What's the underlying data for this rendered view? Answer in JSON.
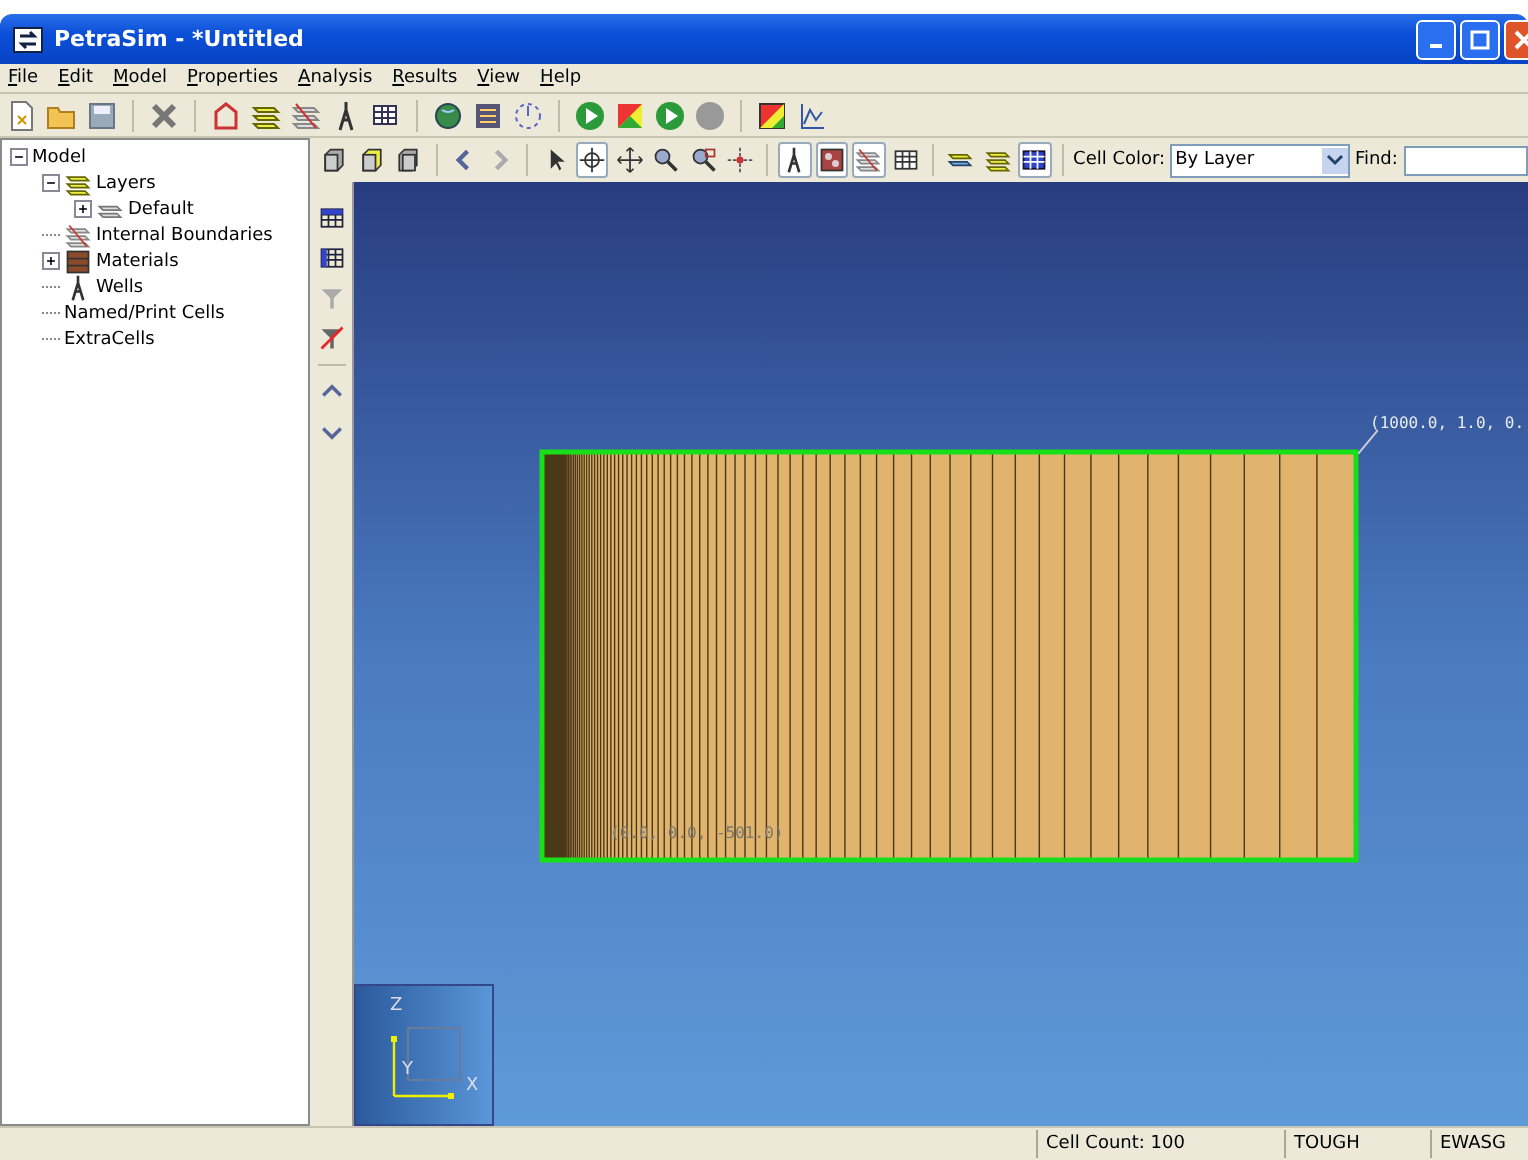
{
  "window": {
    "title": "PetraSim - *Untitled"
  },
  "menu": [
    "File",
    "Edit",
    "Model",
    "Properties",
    "Analysis",
    "Results",
    "View",
    "Help"
  ],
  "view_toolbar": {
    "buttons": [
      {
        "selected": false
      },
      {
        "selected": false
      },
      {
        "selected": false
      },
      {
        "selected": false
      },
      {
        "selected": false
      },
      {
        "selected": false
      },
      {
        "selected": true
      },
      {
        "selected": false
      },
      {
        "selected": false
      },
      {
        "selected": false
      },
      {
        "selected": false
      },
      {
        "selected": true
      },
      {
        "selected": true
      },
      {
        "selected": true
      },
      {
        "selected": false
      },
      {
        "selected": false
      },
      {
        "selected": false
      },
      {
        "selected": true
      }
    ],
    "cell_color": {
      "label": "Cell Color:",
      "value": "By Layer"
    },
    "find": {
      "label": "Find:"
    }
  },
  "tree": [
    {
      "label": "Model",
      "expanded": true,
      "children": [
        {
          "label": "Layers",
          "kind": "layers",
          "expanded": true,
          "children": [
            {
              "label": "Default",
              "kind": "layer",
              "expanded": false
            }
          ]
        },
        {
          "label": "Internal Boundaries",
          "kind": "boundaries"
        },
        {
          "label": "Materials",
          "kind": "materials",
          "expanded": false
        },
        {
          "label": "Wells",
          "kind": "wells"
        },
        {
          "label": "Named/Print Cells"
        },
        {
          "label": "ExtraCells"
        }
      ]
    }
  ],
  "viewport": {
    "label_top_right": "(1000.0, 1.0, 0.",
    "label_bottom_left": "(0.0, 0.0, -501.0)",
    "axes": {
      "z": "Z",
      "y": "Y",
      "x": "X"
    }
  },
  "status_bar": {
    "cell_count": "Cell Count: 100",
    "simulator": "TOUGH",
    "module": "EWASG"
  }
}
